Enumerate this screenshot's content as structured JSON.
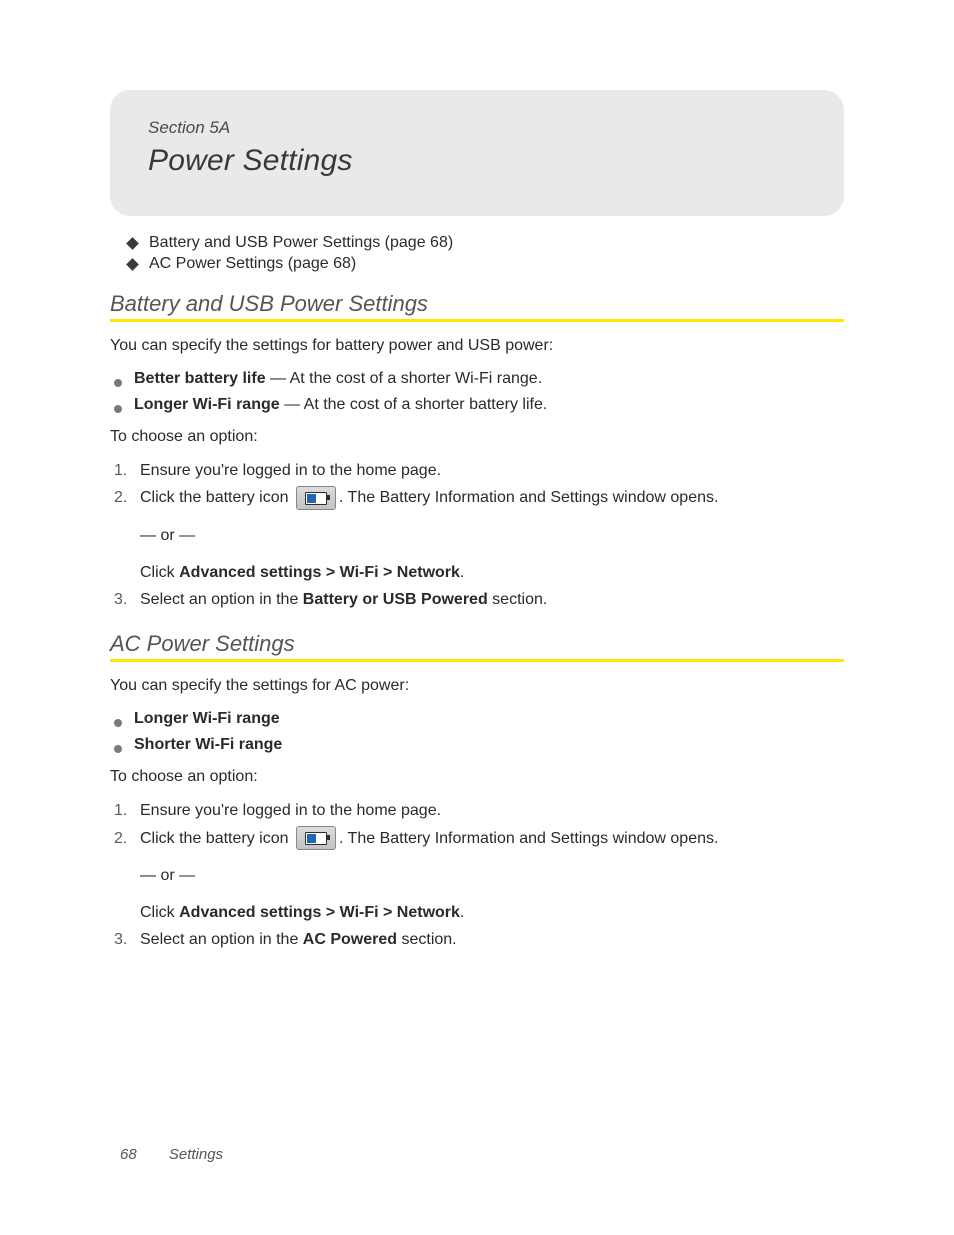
{
  "header": {
    "section_label": "Section 5A",
    "title": "Power Settings"
  },
  "toc": [
    "Battery and USB Power Settings (page 68)",
    "AC Power Settings (page 68)"
  ],
  "section1": {
    "heading": "Battery and USB Power Settings",
    "intro": "You can specify the settings for battery power and USB power:",
    "bullets": [
      {
        "bold": "Better battery life",
        "rest": " — At the cost of a shorter Wi-Fi range."
      },
      {
        "bold": "Longer Wi-Fi range",
        "rest": " — At the cost of a shorter battery life."
      }
    ],
    "choose_label": "To choose an option:",
    "steps": {
      "s1": "Ensure you're logged in to the home page.",
      "s2_pre": "Click the battery icon ",
      "s2_post": ". The Battery Information and Settings window opens.",
      "s2_or": "— or —",
      "s2_click": "Click ",
      "s2_path": "Advanced settings > Wi-Fi > Network",
      "s2_period": ".",
      "s3_pre": "Select an option in the ",
      "s3_bold": "Battery or USB Powered",
      "s3_post": " section."
    }
  },
  "section2": {
    "heading": "AC Power Settings",
    "intro": "You can specify the settings for AC power:",
    "bullets": [
      {
        "bold": "Longer Wi-Fi range",
        "rest": ""
      },
      {
        "bold": "Shorter Wi-Fi range",
        "rest": ""
      }
    ],
    "choose_label": "To choose an option:",
    "steps": {
      "s1": "Ensure you're logged in to the home page.",
      "s2_pre": "Click the battery icon ",
      "s2_post": ". The Battery Information and Settings window opens.",
      "s2_or": "— or —",
      "s2_click": "Click ",
      "s2_path": "Advanced settings > Wi-Fi > Network",
      "s2_period": ".",
      "s3_pre": "Select an option in the ",
      "s3_bold": "AC Powered",
      "s3_post": " section."
    }
  },
  "ordinals": {
    "n1": "1.",
    "n2": "2.",
    "n3": "3."
  },
  "footer": {
    "page_number": "68",
    "chapter": "Settings"
  }
}
